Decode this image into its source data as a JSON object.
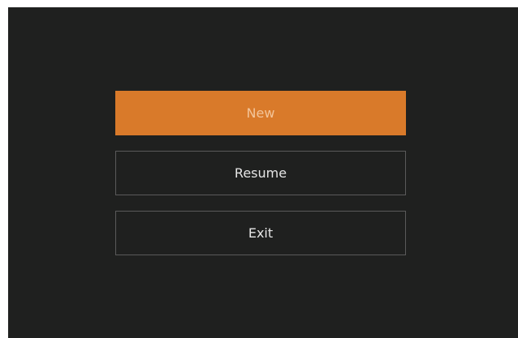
{
  "menu": {
    "items": [
      {
        "label": "New",
        "active": true
      },
      {
        "label": "Resume",
        "active": false
      },
      {
        "label": "Exit",
        "active": false
      }
    ]
  },
  "colors": {
    "background": "#1f201f",
    "accent": "#d97a2a",
    "border": "#5a5a5a",
    "text": "#e6e6e6"
  }
}
